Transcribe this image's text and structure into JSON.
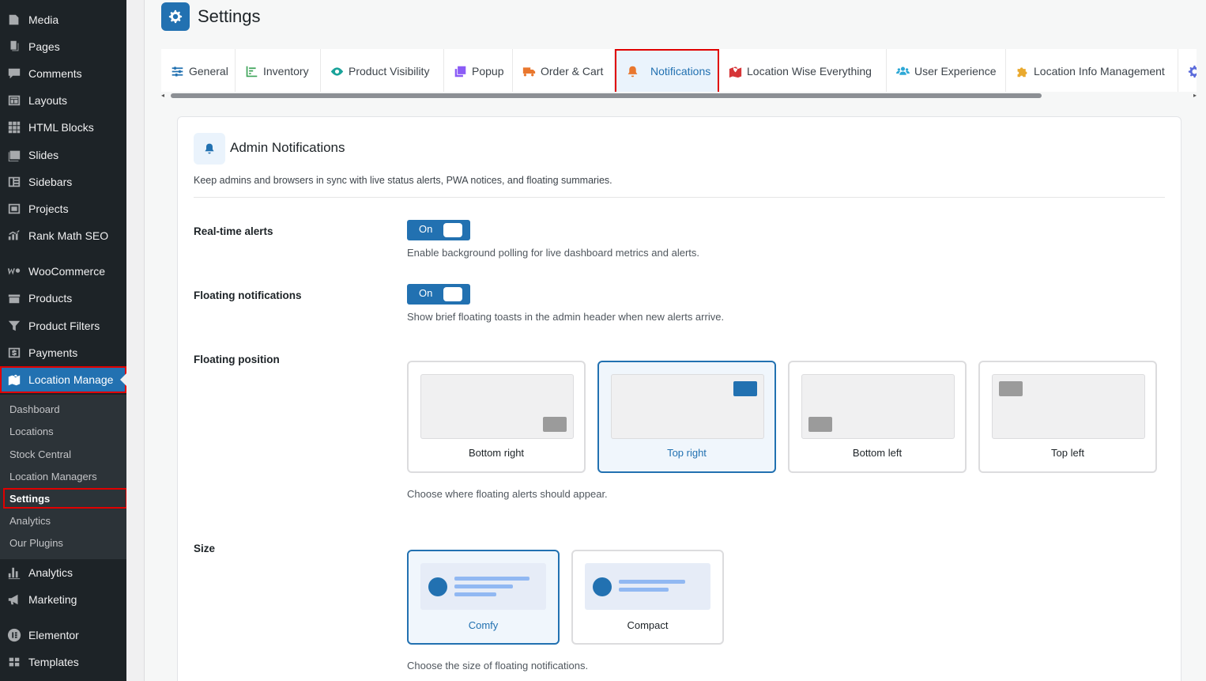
{
  "sidebar": {
    "items": [
      {
        "label": "Media",
        "icon": "media-icon"
      },
      {
        "label": "Pages",
        "icon": "pages-icon"
      },
      {
        "label": "Comments",
        "icon": "comments-icon"
      },
      {
        "label": "Layouts",
        "icon": "layouts-icon"
      },
      {
        "label": "HTML Blocks",
        "icon": "html-blocks-icon"
      },
      {
        "label": "Slides",
        "icon": "slides-icon"
      },
      {
        "label": "Sidebars",
        "icon": "sidebars-icon"
      },
      {
        "label": "Projects",
        "icon": "projects-icon"
      },
      {
        "label": "Rank Math SEO",
        "icon": "rank-math-icon"
      },
      {
        "label": "WooCommerce",
        "icon": "woocommerce-icon"
      },
      {
        "label": "Products",
        "icon": "products-icon"
      },
      {
        "label": "Product Filters",
        "icon": "filter-icon"
      },
      {
        "label": "Payments",
        "icon": "payments-icon"
      },
      {
        "label": "Location Manage",
        "icon": "location-map-icon"
      },
      {
        "label": "Analytics",
        "icon": "analytics-icon"
      },
      {
        "label": "Marketing",
        "icon": "megaphone-icon"
      },
      {
        "label": "Elementor",
        "icon": "elementor-icon"
      },
      {
        "label": "Templates",
        "icon": "templates-icon"
      }
    ],
    "submenu": [
      "Dashboard",
      "Locations",
      "Stock Central",
      "Location Managers",
      "Settings",
      "Analytics",
      "Our Plugins"
    ]
  },
  "page": {
    "title": "Settings"
  },
  "tabs": [
    {
      "label": "General",
      "icon": "sliders-icon",
      "color": "#2271b1"
    },
    {
      "label": "Inventory",
      "icon": "chart-line-icon",
      "color": "#3fa45a"
    },
    {
      "label": "Product Visibility",
      "icon": "eye-icon",
      "color": "#1aa39a"
    },
    {
      "label": "Popup",
      "icon": "clone-icon",
      "color": "#8b5cf6"
    },
    {
      "label": "Order & Cart",
      "icon": "truck-icon",
      "color": "#e9772e"
    },
    {
      "label": "Notifications",
      "icon": "bell-icon",
      "color": "#e9772e"
    },
    {
      "label": "Location Wise Everything",
      "icon": "map-marked-icon",
      "color": "#d63638"
    },
    {
      "label": "User Experience",
      "icon": "users-icon",
      "color": "#2ea8d6"
    },
    {
      "label": "Location Info Management",
      "icon": "puzzle-icon",
      "color": "#e9a92e"
    }
  ],
  "card": {
    "title": "Admin Notifications",
    "description": "Keep admins and browsers in sync with live status alerts, PWA notices, and floating summaries."
  },
  "settings": {
    "realtime": {
      "label": "Real-time alerts",
      "toggle": "On",
      "help": "Enable background polling for live dashboard metrics and alerts."
    },
    "floating": {
      "label": "Floating notifications",
      "toggle": "On",
      "help": "Show brief floating toasts in the admin header when new alerts arrive."
    },
    "position": {
      "label": "Floating position",
      "options": [
        "Bottom right",
        "Top right",
        "Bottom left",
        "Top left"
      ],
      "selected": "Top right",
      "help": "Choose where floating alerts should appear."
    },
    "size": {
      "label": "Size",
      "options": [
        "Comfy",
        "Compact"
      ],
      "selected": "Comfy",
      "help": "Choose the size of floating notifications."
    }
  },
  "colors": {
    "accent": "#2271b1",
    "sidebar": "#1d2327",
    "highlight": "#e00000"
  }
}
